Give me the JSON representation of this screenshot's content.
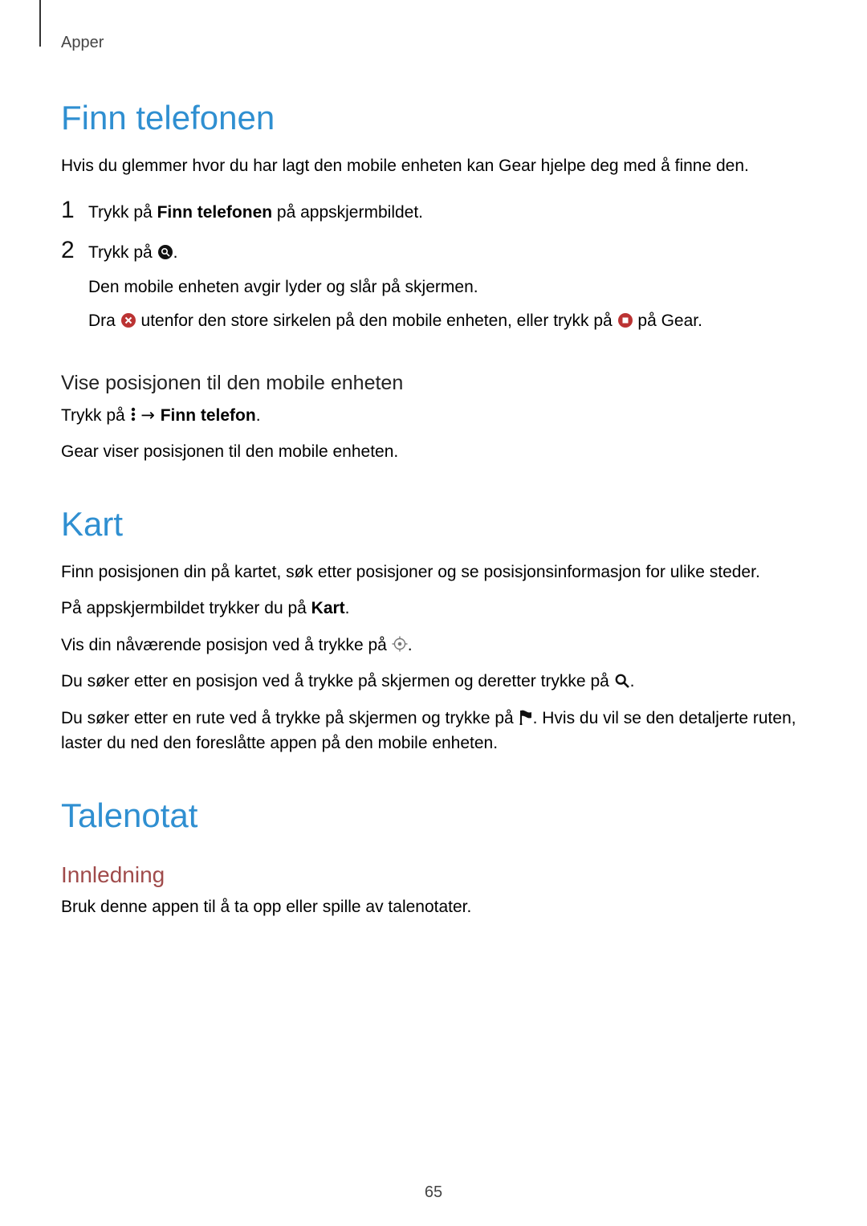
{
  "header": {
    "section_label": "Apper"
  },
  "page_number": "65",
  "section1": {
    "title": "Finn telefonen",
    "intro": "Hvis du glemmer hvor du har lagt den mobile enheten kan Gear hjelpe deg med å finne den.",
    "step1_pre": "Trykk på ",
    "step1_bold": "Finn telefonen",
    "step1_post": " på appskjermbildet.",
    "step2_pre": "Trykk på ",
    "step2_post": ".",
    "step2_sub1": "Den mobile enheten avgir lyder og slår på skjermen.",
    "step2_sub2_a": "Dra ",
    "step2_sub2_b": " utenfor den store sirkelen på den mobile enheten, eller trykk på ",
    "step2_sub2_c": " på Gear.",
    "subheading": "Vise posisjonen til den mobile enheten",
    "subline_a": "Trykk på ",
    "subline_arrow": " → ",
    "subline_b_bold": "Finn telefon",
    "subline_c": ".",
    "subline2": "Gear viser posisjonen til den mobile enheten."
  },
  "section2": {
    "title": "Kart",
    "p1": "Finn posisjonen din på kartet, søk etter posisjoner og se posisjonsinformasjon for ulike steder.",
    "p2_a": "På appskjermbildet trykker du på ",
    "p2_bold": "Kart",
    "p2_b": ".",
    "p3_a": "Vis din nåværende posisjon ved å trykke på ",
    "p3_b": ".",
    "p4_a": "Du søker etter en posisjon ved å trykke på skjermen og deretter trykke på ",
    "p4_b": ".",
    "p5_a": "Du søker etter en rute ved å trykke på skjermen og trykke på ",
    "p5_b": ". Hvis du vil se den detaljerte ruten, laster du ned den foreslåtte appen på den mobile enheten."
  },
  "section3": {
    "title": "Talenotat",
    "sub": "Innledning",
    "p1": "Bruk denne appen til å ta opp eller spille av talenotater."
  }
}
